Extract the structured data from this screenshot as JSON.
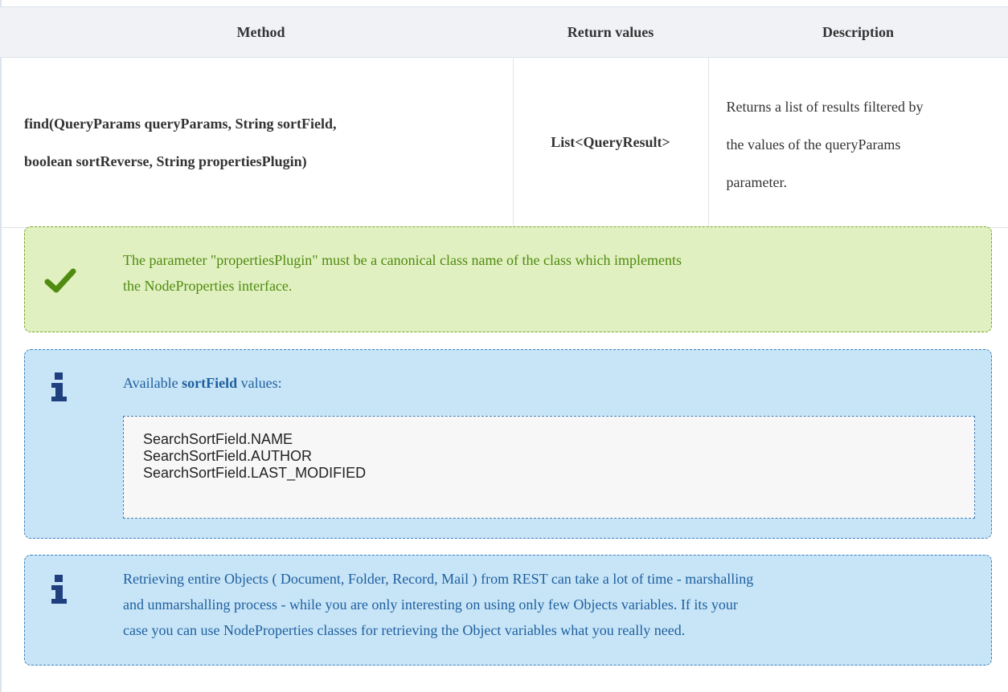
{
  "table": {
    "headers": [
      "Method",
      "Return values",
      "Description"
    ],
    "row": {
      "method_line1": "find(QueryParams queryParams, String sortField,",
      "method_line2": "boolean sortReverse, String propertiesPlugin)",
      "return_value": "List<QueryResult>",
      "description_line1": "Returns a list of results filtered by",
      "description_line2": "the values of the queryParams",
      "description_line3": "parameter."
    }
  },
  "success_callout": {
    "icon": "checkmark-icon",
    "line1": "The parameter \"propertiesPlugin\" must be a canonical class name of the class which implements",
    "line2": "the NodeProperties interface."
  },
  "info_callout_sortfield": {
    "icon": "info-icon",
    "intro_prefix": "Available ",
    "intro_bold": "sortField",
    "intro_suffix": " values:",
    "code_lines": [
      "SearchSortField.NAME",
      "SearchSortField.AUTHOR",
      "SearchSortField.LAST_MODIFIED"
    ]
  },
  "info_callout_rest": {
    "icon": "info-icon",
    "line1": "Retrieving entire Objects ( Document, Folder, Record, Mail ) from REST can take a lot of time - marshalling",
    "line2": "and unmarshalling process - while you are only interesting on using only few Objects variables. If its your",
    "line3": "case you can use NodeProperties classes for retrieving the Object variables what you really need."
  },
  "colors": {
    "success_bg": "#e1f0c0",
    "success_text": "#4e8b10",
    "info_bg": "#c7e5f7",
    "info_text": "#1f5f9f",
    "header_bg": "#f0f2f5"
  }
}
